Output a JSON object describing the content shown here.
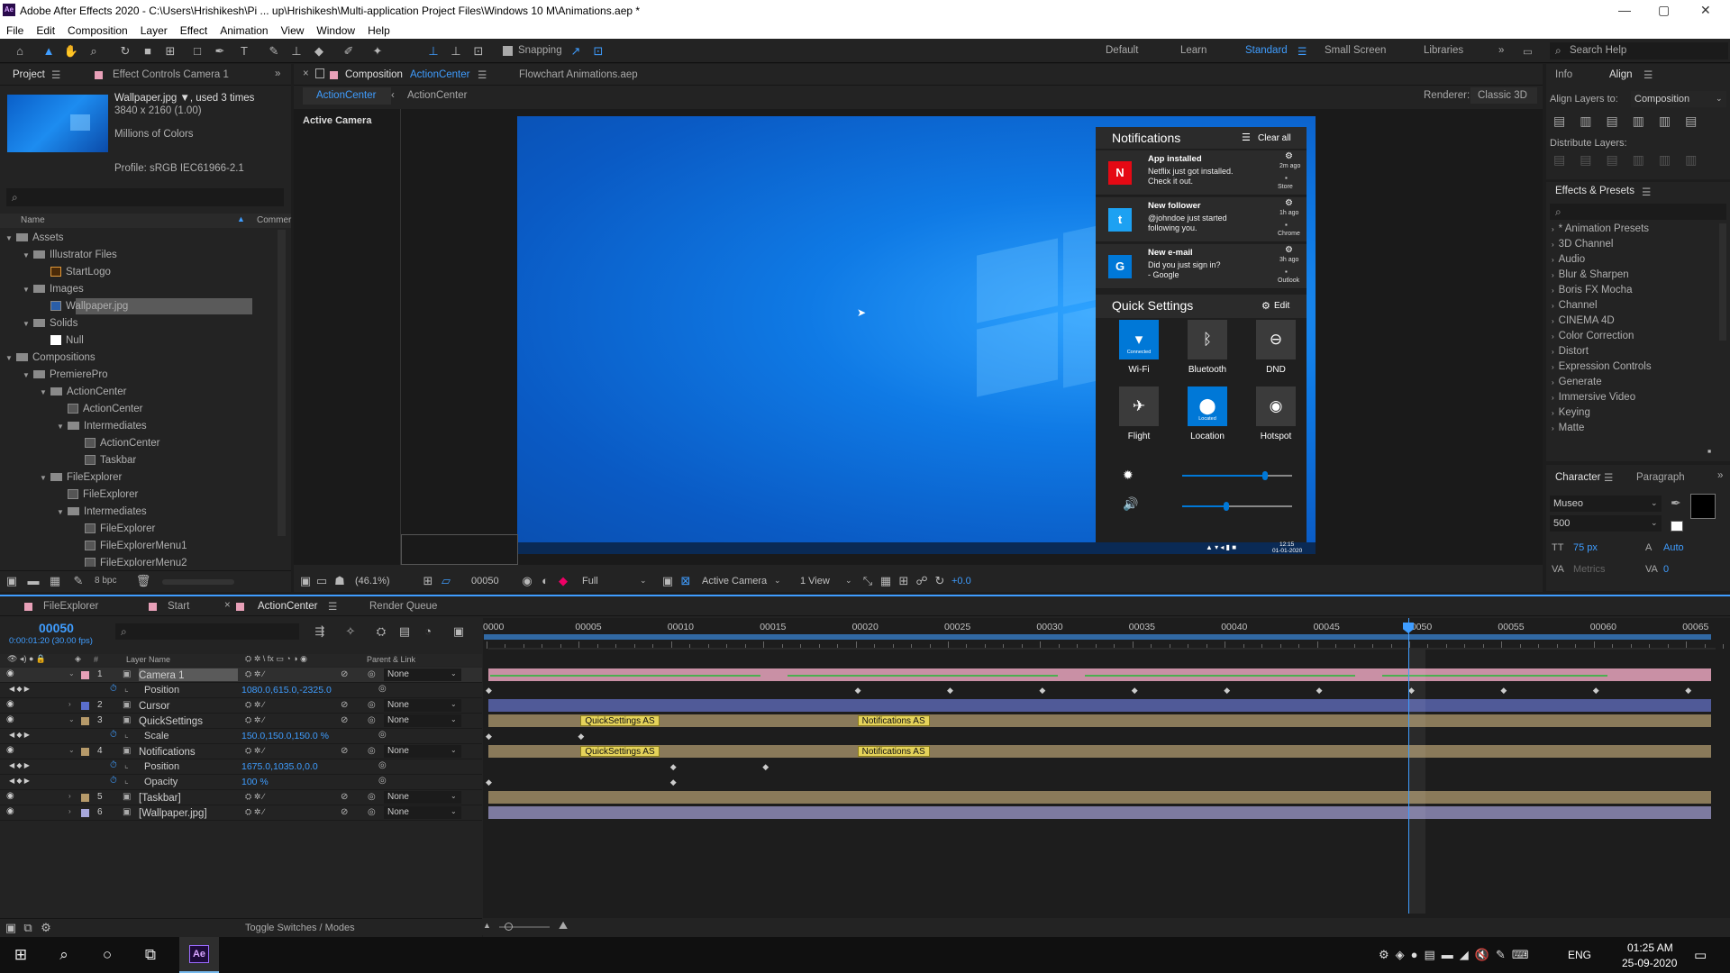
{
  "window": {
    "app_badge": "Ae",
    "title": "Adobe After Effects 2020 - C:\\Users\\Hrishikesh\\Pi ... up\\Hrishikesh\\Multi-application Project Files\\Windows 10 M\\Animations.aep *",
    "min": "—",
    "max": "▢",
    "close": "✕"
  },
  "menu": [
    "File",
    "Edit",
    "Composition",
    "Layer",
    "Effect",
    "Animation",
    "View",
    "Window",
    "Help"
  ],
  "toolbar": {
    "snapping": "Snapping",
    "workspaces": [
      "Default",
      "Learn",
      "Standard",
      "Small Screen",
      "Libraries"
    ],
    "search_help": "Search Help"
  },
  "project": {
    "tab_project": "Project",
    "tab_effects": "Effect Controls Camera 1",
    "file_name": "Wallpaper.jpg ▼, used 3 times",
    "dims": "3840 x 2160 (1.00)",
    "colors": "Millions of Colors",
    "profile": "Profile: sRGB IEC61966-2.1",
    "col_name": "Name",
    "col_comment": "Commer",
    "tree": [
      {
        "label": "Assets",
        "type": "folder",
        "indent": 0
      },
      {
        "label": "Illustrator Files",
        "type": "folder",
        "indent": 1
      },
      {
        "label": "StartLogo",
        "type": "ai",
        "indent": 2
      },
      {
        "label": "Images",
        "type": "folder",
        "indent": 1
      },
      {
        "label": "Wallpaper.jpg",
        "type": "img",
        "indent": 2,
        "selected": true
      },
      {
        "label": "Solids",
        "type": "folder",
        "indent": 1
      },
      {
        "label": "Null",
        "type": "solid",
        "indent": 2
      },
      {
        "label": "Compositions",
        "type": "folder",
        "indent": 0
      },
      {
        "label": "PremierePro",
        "type": "folder",
        "indent": 1
      },
      {
        "label": "ActionCenter",
        "type": "folder",
        "indent": 2
      },
      {
        "label": "ActionCenter",
        "type": "comp",
        "indent": 3
      },
      {
        "label": "Intermediates",
        "type": "folder",
        "indent": 3
      },
      {
        "label": "ActionCenter",
        "type": "comp",
        "indent": 4
      },
      {
        "label": "Taskbar",
        "type": "comp",
        "indent": 4
      },
      {
        "label": "FileExplorer",
        "type": "folder",
        "indent": 2
      },
      {
        "label": "FileExplorer",
        "type": "comp",
        "indent": 3
      },
      {
        "label": "Intermediates",
        "type": "folder",
        "indent": 3
      },
      {
        "label": "FileExplorer",
        "type": "comp",
        "indent": 4
      },
      {
        "label": "FileExplorerMenu1",
        "type": "comp",
        "indent": 4
      },
      {
        "label": "FileExplorerMenu2",
        "type": "comp",
        "indent": 4
      }
    ],
    "bpc": "8 bpc"
  },
  "composition": {
    "tab_label": "Composition",
    "tab_name": "ActionCenter",
    "flowchart": "Flowchart Animations.aep",
    "crumb1": "ActionCenter",
    "crumb2": "ActionCenter",
    "renderer_label": "Renderer:",
    "renderer": "Classic 3D",
    "active_camera": "Active Camera",
    "zoom": "(46.1%)",
    "timecode": "00050",
    "resolution": "Full",
    "view_camera": "Active Camera",
    "views": "1 View",
    "exposure": "+0.0"
  },
  "action_center": {
    "title": "Notifications",
    "clear": "Clear all",
    "notifications": [
      {
        "title": "App installed",
        "body1": "Netflix just got installed.",
        "body2": "Check it out.",
        "time": "2m ago",
        "src": "Store",
        "icon": "N",
        "color": "#e50914"
      },
      {
        "title": "New follower",
        "body1": "@johndoe just started",
        "body2": "following you.",
        "time": "1h ago",
        "src": "Chrome",
        "icon": "t",
        "color": "#1da1f2"
      },
      {
        "title": "New e-mail",
        "body1": "Did you just sign in?",
        "body2": "- Google",
        "time": "3h ago",
        "src": "Outlook",
        "icon": "G",
        "color": "#0078d7"
      }
    ],
    "qs_title": "Quick Settings",
    "qs_edit": "Edit",
    "tiles": [
      {
        "label": "Wi-Fi",
        "sub": "Connected",
        "on": true,
        "icon": "▾"
      },
      {
        "label": "Bluetooth",
        "on": false,
        "icon": "ᛒ"
      },
      {
        "label": "DND",
        "on": false,
        "icon": "⊖"
      },
      {
        "label": "Flight",
        "on": false,
        "icon": "✈"
      },
      {
        "label": "Location",
        "sub": "Located",
        "on": true,
        "icon": "⬤"
      },
      {
        "label": "Hotspot",
        "on": false,
        "icon": "◉"
      }
    ],
    "brightness": 0.75,
    "volume": 0.4,
    "tray_time": "12:15",
    "tray_date": "01-01-2020"
  },
  "info_align": {
    "tab_info": "Info",
    "tab_align": "Align",
    "align_to": "Align Layers to:",
    "align_target": "Composition",
    "distribute": "Distribute Layers:"
  },
  "effects": {
    "title": "Effects & Presets",
    "items": [
      "* Animation Presets",
      "3D Channel",
      "Audio",
      "Blur & Sharpen",
      "Boris FX Mocha",
      "Channel",
      "CINEMA 4D",
      "Color Correction",
      "Distort",
      "Expression Controls",
      "Generate",
      "Immersive Video",
      "Keying",
      "Matte"
    ]
  },
  "character": {
    "tab_char": "Character",
    "tab_para": "Paragraph",
    "font": "Museo",
    "weight": "500",
    "size": "75 px",
    "leading": "Auto",
    "kerning": "Metrics",
    "tracking": "0"
  },
  "timeline": {
    "tabs": [
      "FileExplorer",
      "Start",
      "ActionCenter",
      "Render Queue"
    ],
    "timecode": "00050",
    "tc_sub": "0:00:01:20 (30.00 fps)",
    "col_layer": "Layer Name",
    "col_parent": "Parent & Link",
    "ruler": [
      "0000",
      "00005",
      "00010",
      "00015",
      "00020",
      "00025",
      "00030",
      "00035",
      "00040",
      "00045",
      "00050",
      "00055",
      "00060",
      "00065"
    ],
    "rows": [
      {
        "num": "1",
        "name": "Camera 1",
        "kind": "layer",
        "color": "#e8a0b8",
        "parent": "None",
        "bar": "#c990a5"
      },
      {
        "name": "Position",
        "kind": "prop",
        "value": "1080.0,615.0,-2325.0"
      },
      {
        "num": "2",
        "name": "Cursor",
        "kind": "layer",
        "color": "#5a6ecc",
        "parent": "None",
        "bar": "#505a98"
      },
      {
        "num": "3",
        "name": "QuickSettings",
        "kind": "layer",
        "color": "#b69a6a",
        "parent": "None",
        "bar": "#8a7a5a"
      },
      {
        "name": "Scale",
        "kind": "prop",
        "value": "150.0,150.0,150.0 %"
      },
      {
        "num": "4",
        "name": "Notifications",
        "kind": "layer",
        "color": "#b69a6a",
        "parent": "None",
        "bar": "#8a7a5a"
      },
      {
        "name": "Position",
        "kind": "prop",
        "value": "1675.0,1035.0,0.0"
      },
      {
        "name": "Opacity",
        "kind": "prop",
        "value": "100 %"
      },
      {
        "num": "5",
        "name": "[Taskbar]",
        "kind": "layer",
        "color": "#b69a6a",
        "parent": "None",
        "bar": "#8a7a5a"
      },
      {
        "num": "6",
        "name": "[Wallpaper.jpg]",
        "kind": "layer",
        "color": "#a8a8dc",
        "parent": "None",
        "bar": "#7d7aa0"
      }
    ],
    "tags": {
      "qs": "QuickSettings AS",
      "notif": "Notifications AS"
    },
    "toggle": "Toggle Switches / Modes"
  },
  "taskbar": {
    "lang": "ENG",
    "time": "01:25 AM",
    "date": "25-09-2020",
    "app": "Ae"
  }
}
